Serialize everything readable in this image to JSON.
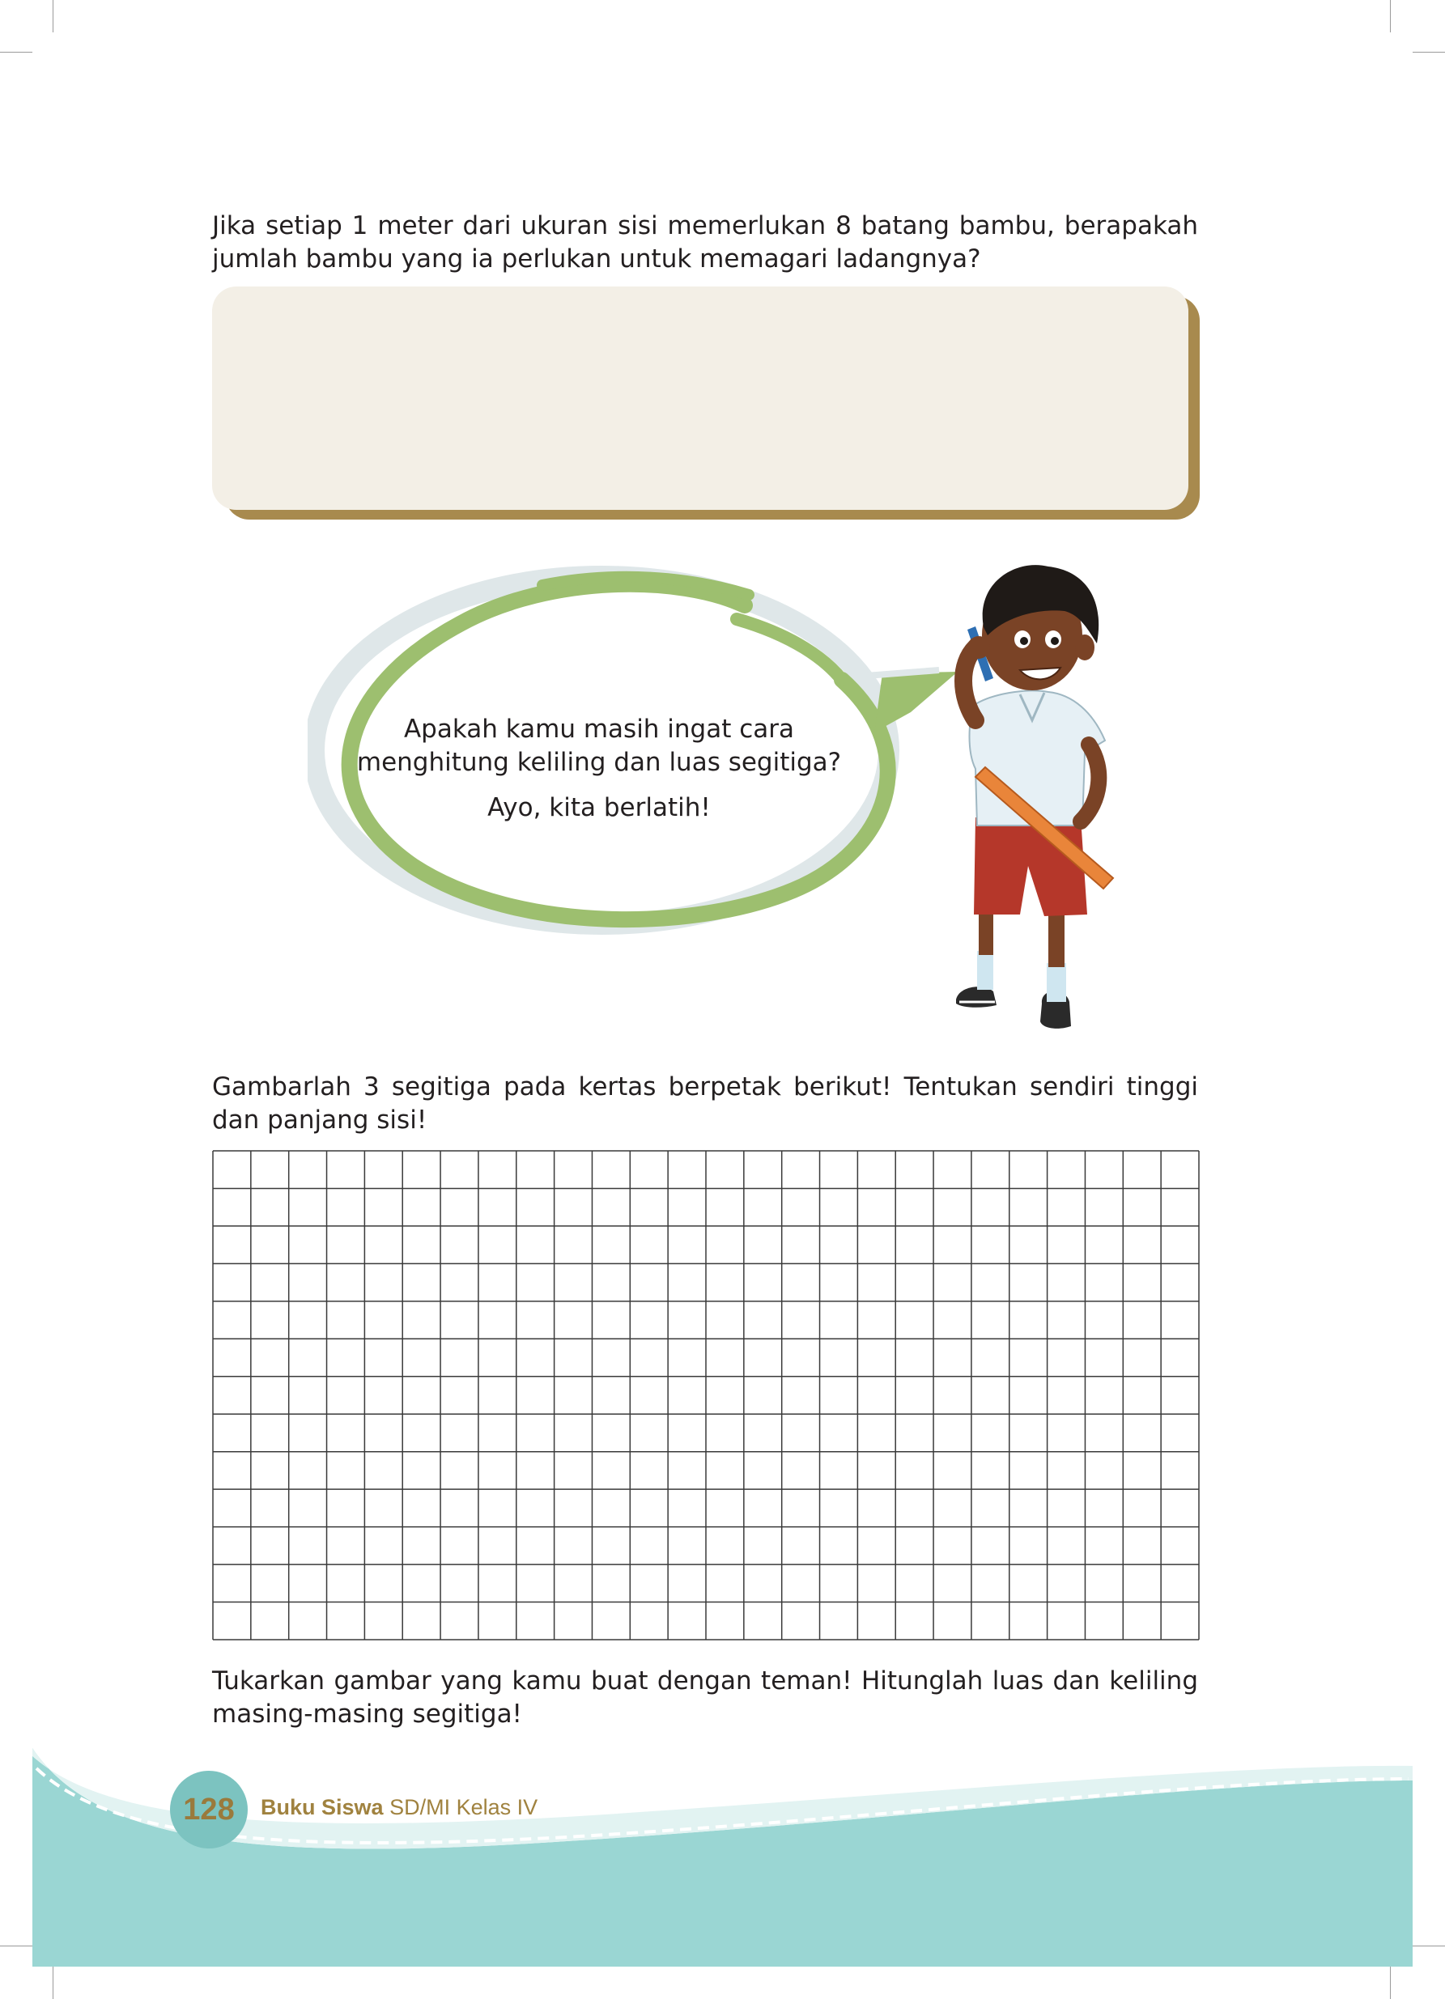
{
  "question": {
    "text": "Jika setiap 1 meter dari ukuran sisi memerlukan 8 batang bambu, berapakah jumlah bambu yang ia perlukan untuk memagari ladangnya?"
  },
  "answer_box": {
    "value": ""
  },
  "speech_bubble": {
    "line1": "Apakah kamu masih ingat cara",
    "line2": "menghitung keliling dan luas segitiga?",
    "line3": "Ayo, kita berlatih!"
  },
  "instruction_draw": {
    "text": "Gambarlah 3 segitiga pada kertas berpetak berikut! Tentukan sendiri tinggi dan panjang sisi!"
  },
  "grid_paper": {
    "columns": 26,
    "rows": 13
  },
  "instruction_exchange": {
    "text": "Tukarkan gambar yang kamu buat dengan teman! Hitunglah luas dan keliling masing-masing segitiga!"
  },
  "footer": {
    "page_number": "128",
    "book_title": "Buku Siswa",
    "book_subtitle": "SD/MI Kelas IV"
  },
  "colors": {
    "answer_box": "#f3efe6",
    "answer_shadow": "#a88a4e",
    "bubble_green": "#9dbf6f",
    "footer_teal": "#9ad6d3",
    "footer_text": "#a0823f"
  }
}
